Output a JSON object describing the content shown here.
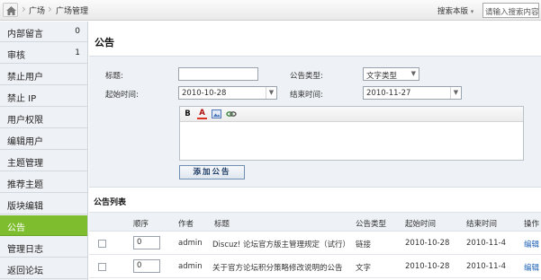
{
  "topbar": {
    "breadcrumb": [
      "广场",
      "广场管理"
    ],
    "search_scope": "搜索本版",
    "search_placeholder": "请输入搜索内容"
  },
  "sidebar": {
    "items": [
      {
        "label": "内部留言",
        "count": "0"
      },
      {
        "label": "审核",
        "count": "1"
      },
      {
        "label": "禁止用户",
        "count": ""
      },
      {
        "label": "禁止 IP",
        "count": ""
      },
      {
        "label": "用户权限",
        "count": ""
      },
      {
        "label": "编辑用户",
        "count": ""
      },
      {
        "label": "主题管理",
        "count": ""
      },
      {
        "label": "推荐主题",
        "count": ""
      },
      {
        "label": "版块编辑",
        "count": ""
      },
      {
        "label": "公告",
        "count": ""
      },
      {
        "label": "管理日志",
        "count": ""
      },
      {
        "label": "返回论坛",
        "count": ""
      }
    ],
    "active_index": 9,
    "active_color": "#7dbd2e"
  },
  "page": {
    "title": "公告"
  },
  "form": {
    "title_label": "标题:",
    "title_value": "",
    "type_label": "公告类型:",
    "type_value": "文字类型",
    "start_label": "起始时间:",
    "start_value": "2010-10-28",
    "end_label": "结束时间:",
    "end_value": "2010-11-27",
    "editor_tools": [
      "bold-icon",
      "font-color-icon",
      "image-icon",
      "link-icon"
    ],
    "editor_bold_glyph": "B",
    "editor_color_glyph": "A",
    "submit_label": "添加公告"
  },
  "list": {
    "title": "公告列表",
    "columns": [
      "顺序",
      "作者",
      "标题",
      "公告类型",
      "起始时间",
      "结束时间",
      "操作"
    ],
    "rows": [
      {
        "order": "0",
        "author": "admin",
        "title": "Discuz! 论坛官方版主管理规定（试行）",
        "type": "链接",
        "start": "2010-10-28",
        "end": "2010-11-4",
        "action": "编辑"
      },
      {
        "order": "0",
        "author": "admin",
        "title": "关于官方论坛积分策略修改说明的公告",
        "type": "文字",
        "start": "2010-10-28",
        "end": "2010-11-4",
        "action": "编辑"
      }
    ]
  },
  "colors": {
    "link": "#1f63b6",
    "panel": "#eef1f5"
  }
}
